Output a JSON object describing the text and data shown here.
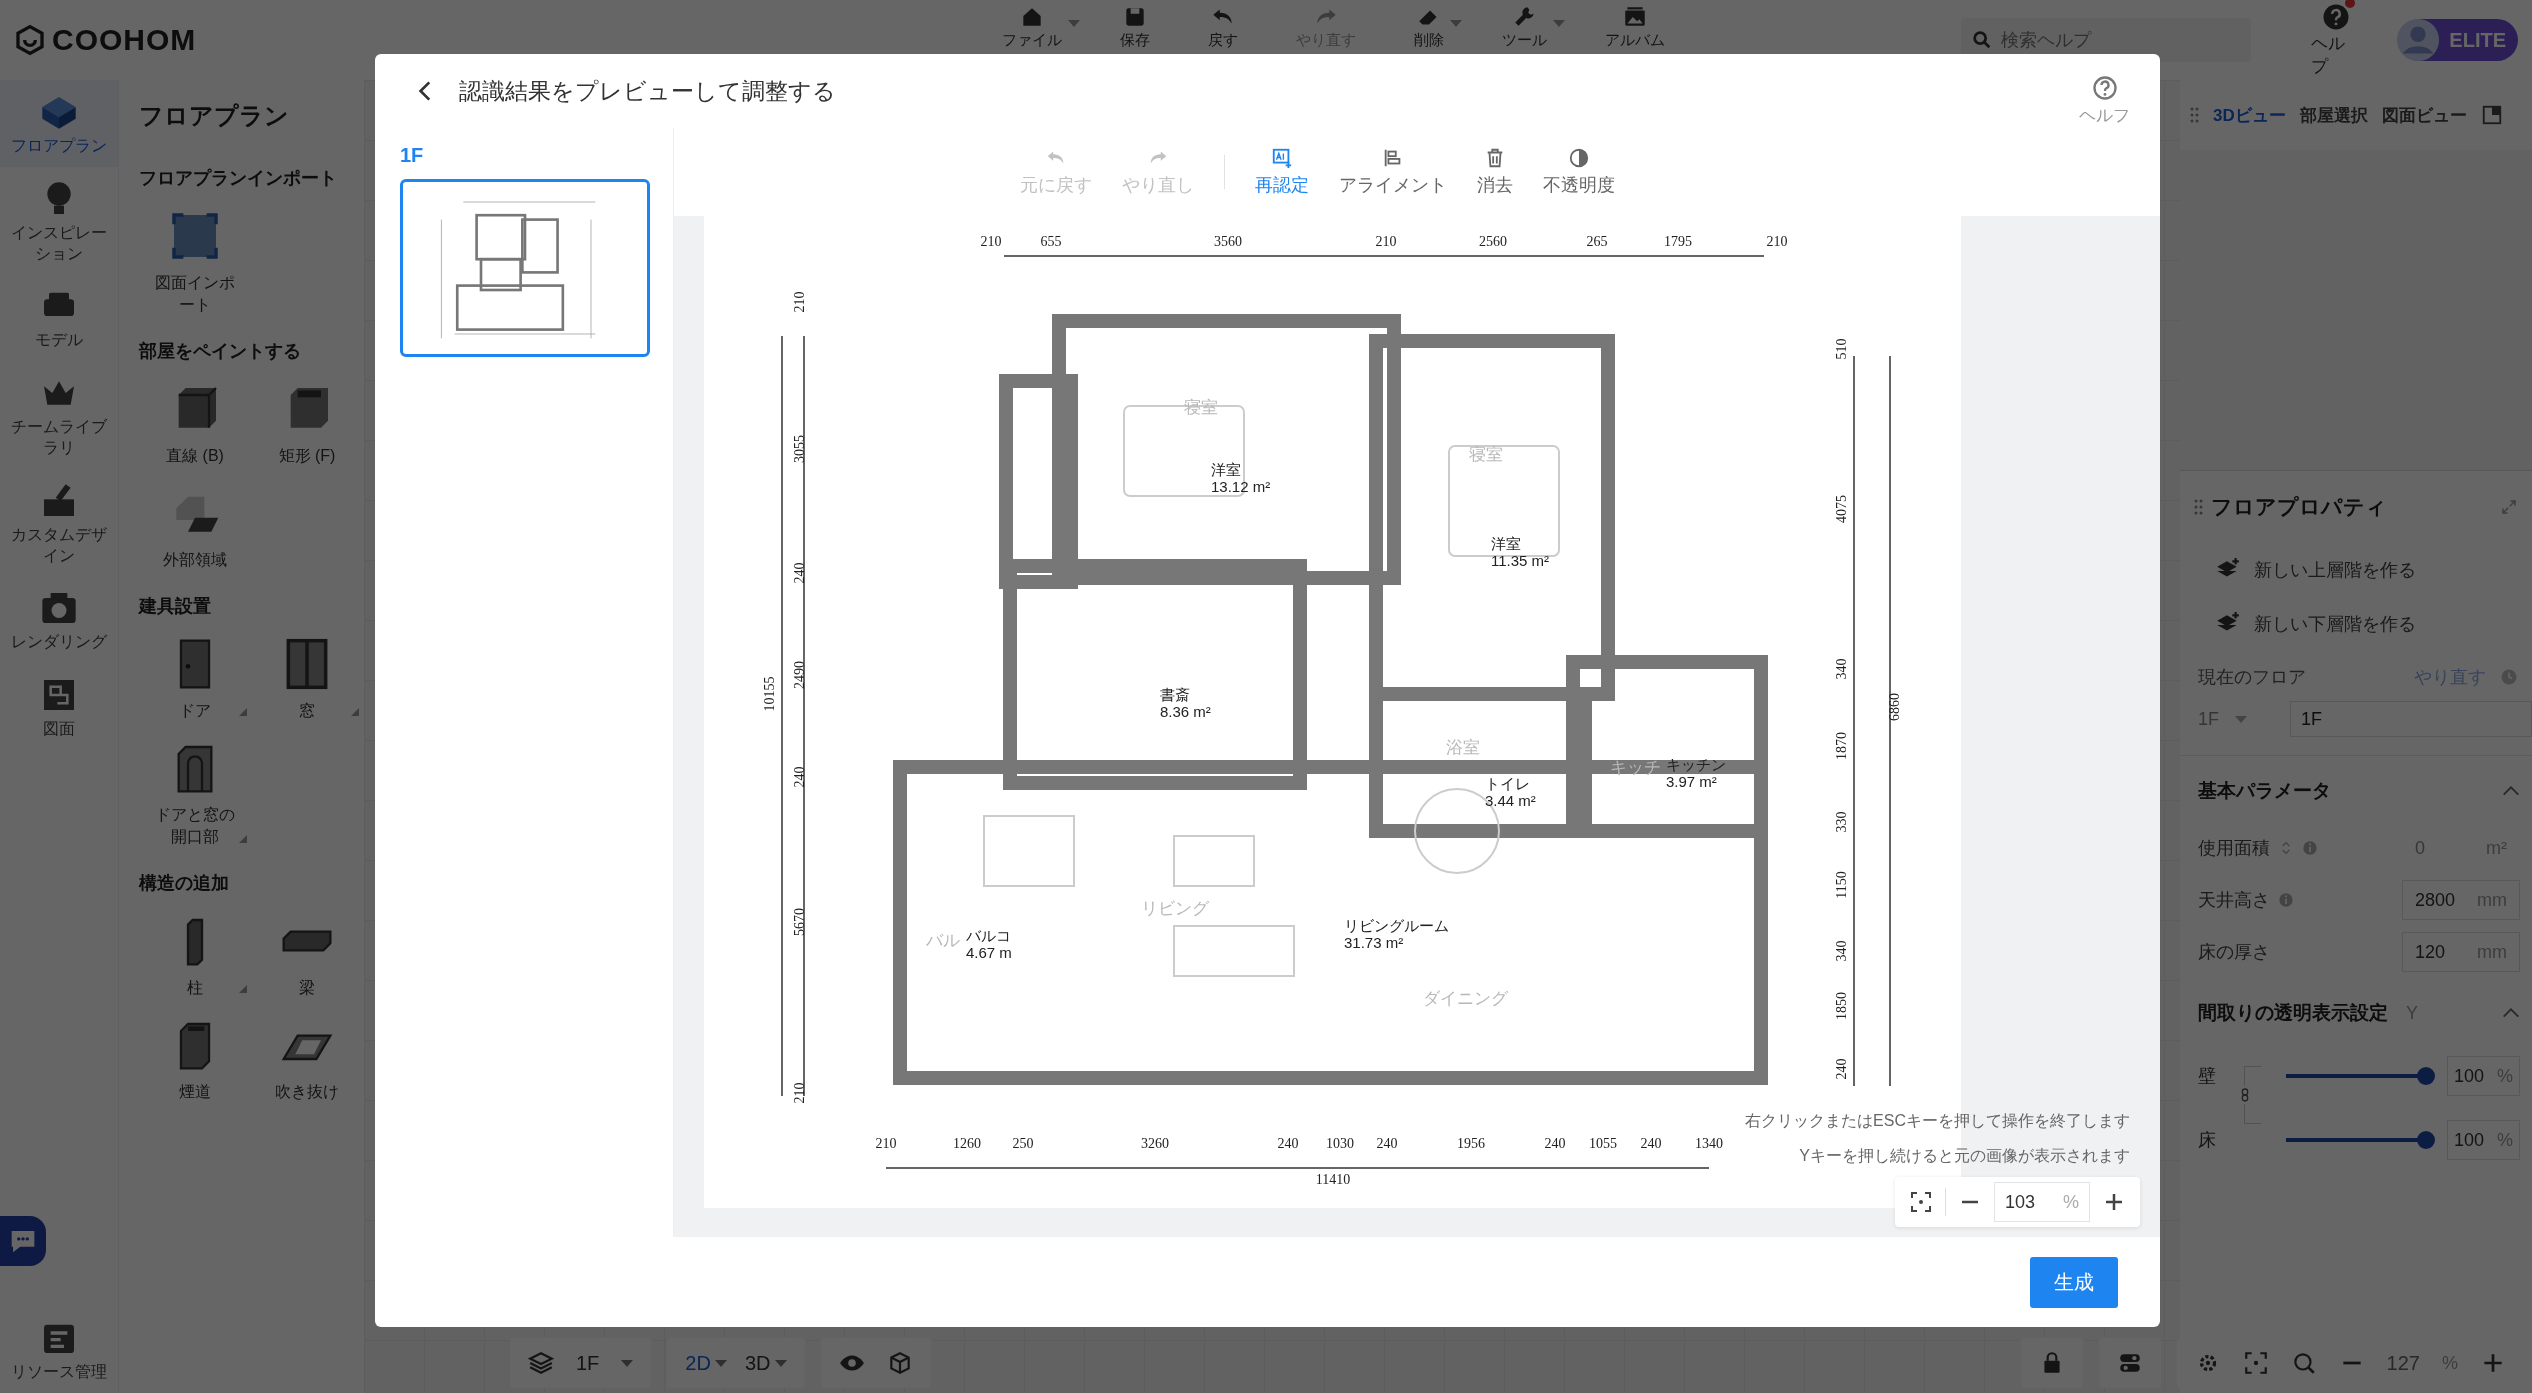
{
  "app": {
    "logo": "COOHOM",
    "toolbar": [
      {
        "label": "ファイル",
        "dropdown": true
      },
      {
        "label": "保存",
        "dropdown": false
      },
      {
        "label": "戻す",
        "dropdown": false
      },
      {
        "label": "やり直す",
        "dropdown": false,
        "disabled": true
      },
      {
        "label": "削除",
        "dropdown": true
      },
      {
        "label": "ツール",
        "dropdown": true
      },
      {
        "label": "アルバム",
        "dropdown": false
      }
    ],
    "search": {
      "placeholder": "検索ヘルプ"
    },
    "help": {
      "label": "ヘルプ",
      "notification": true
    },
    "plan_badge": "ELITE"
  },
  "left_rail": [
    {
      "label": "フロアプラン",
      "selected": true
    },
    {
      "label": "インスピレーション",
      "selected": false
    },
    {
      "label": "モデル",
      "selected": false
    },
    {
      "label": "チームライブラリ",
      "selected": false
    },
    {
      "label": "カスタムデザイン",
      "selected": false
    },
    {
      "label": "レンダリング",
      "selected": false
    },
    {
      "label": "図面",
      "selected": false
    }
  ],
  "left_rail_bottom": "リソース管理",
  "left_panel": {
    "title": "フロアプラン",
    "sections": [
      {
        "title": "フロアプランインポート",
        "tools": [
          {
            "label": "図面インポート",
            "more": false
          }
        ]
      },
      {
        "title": "部屋をペイントする",
        "tools": [
          {
            "label": "直線 (B)",
            "more": false
          },
          {
            "label": "矩形 (F)",
            "more": false
          },
          {
            "label": "外部領域",
            "more": false
          }
        ]
      },
      {
        "title": "建具設置",
        "tools": [
          {
            "label": "ドア",
            "more": true
          },
          {
            "label": "窓",
            "more": true
          },
          {
            "label": "ドアと窓の開口部",
            "more": true
          }
        ]
      },
      {
        "title": "構造の追加",
        "tools": [
          {
            "label": "柱",
            "more": true
          },
          {
            "label": "梁",
            "more": false
          },
          {
            "label": "煙道",
            "more": false
          },
          {
            "label": "吹き抜け",
            "more": false
          }
        ]
      }
    ]
  },
  "right_panel": {
    "view_tabs": [
      {
        "label": "3Dビュー",
        "selected": true
      },
      {
        "label": "部屋選択",
        "selected": false
      },
      {
        "label": "図面ビュー",
        "selected": false
      }
    ],
    "title": "フロアプロパティ",
    "actions": [
      "新しい上層階を作る",
      "新しい下層階を作る"
    ],
    "current_floor": {
      "label": "現在のフロア",
      "link": "やり直す",
      "select": "1F",
      "value": "1F"
    },
    "basic": {
      "title": "基本パラメータ",
      "expanded": true,
      "rows": [
        {
          "label": "使用面積",
          "value": "0",
          "unit": "m²",
          "kind": "readonly"
        },
        {
          "label": "天井高さ",
          "value": "2800",
          "unit": "mm",
          "kind": "input"
        },
        {
          "label": "床の厚さ",
          "value": "120",
          "unit": "mm",
          "kind": "input"
        }
      ]
    },
    "transparency": {
      "title": "間取りの透明表示設定",
      "shortcut": "Y",
      "expanded": true,
      "linked": true,
      "sliders": [
        {
          "label": "壁",
          "level": 1,
          "value": "100",
          "unit": "%"
        },
        {
          "label": "床",
          "level": 1,
          "value": "100",
          "unit": "%"
        }
      ]
    }
  },
  "bottom_bar": {
    "floor": "1F",
    "modes": [
      {
        "label": "2D",
        "selected": true
      },
      {
        "label": "3D",
        "selected": false
      }
    ],
    "zoom": "127",
    "zoom_unit": "%"
  },
  "dialog": {
    "title": "認識結果をプレビューして調整する",
    "help": "ヘルフ",
    "floors": [
      {
        "label": "1F",
        "selected": true
      }
    ],
    "tools": [
      {
        "label": "元に戻す",
        "disabled": true,
        "active": false
      },
      {
        "label": "やり直し",
        "disabled": true,
        "active": false
      },
      {
        "label": "再認定",
        "disabled": false,
        "active": true
      },
      {
        "label": "アライメント",
        "disabled": false,
        "active": false
      },
      {
        "label": "消去",
        "disabled": false,
        "active": false
      },
      {
        "label": "不透明度",
        "disabled": false,
        "active": false
      }
    ],
    "floor_plan": {
      "top_dimensions": [
        "210",
        "655",
        "3560",
        "210",
        "2560",
        "265",
        "1795",
        "210"
      ],
      "bottom_dimensions": [
        "210",
        "1260",
        "250",
        "3260",
        "240",
        "1030",
        "240",
        "1956",
        "240",
        "1055",
        "240",
        "1340"
      ],
      "bottom_total": "11410",
      "left_total": "10155",
      "left_dimensions": [
        "210",
        "3055",
        "240",
        "2490",
        "240",
        "5670",
        "210"
      ],
      "right_dimensions": [
        "510",
        "4075",
        "340",
        "1870",
        "330",
        "1150",
        "340",
        "1850",
        "240"
      ],
      "right_total": "6860",
      "rooms": [
        {
          "name": "洋室",
          "area": "13.12 m²"
        },
        {
          "name": "洋室",
          "area": "11.35 m²"
        },
        {
          "name": "書斎",
          "area": "8.36 m²"
        },
        {
          "name": "トイレ",
          "area": "3.44 m²"
        },
        {
          "name": "キッチン",
          "area": "3.97 m²"
        },
        {
          "name": "バルコ",
          "area": "4.67 m"
        },
        {
          "name": "リビングルーム",
          "area": "31.73 m²"
        }
      ],
      "faded_labels": [
        "寝室",
        "寝室",
        "浴室",
        "キッチ",
        "バル",
        "リビング",
        "ダイニング"
      ]
    },
    "hints": [
      "右クリックまたはESCキーを押して操作を終了します",
      "Yキーを押し続けると元の画像が表示されます"
    ],
    "zoom": "103",
    "zoom_unit": "%",
    "primary_button": "生成"
  }
}
